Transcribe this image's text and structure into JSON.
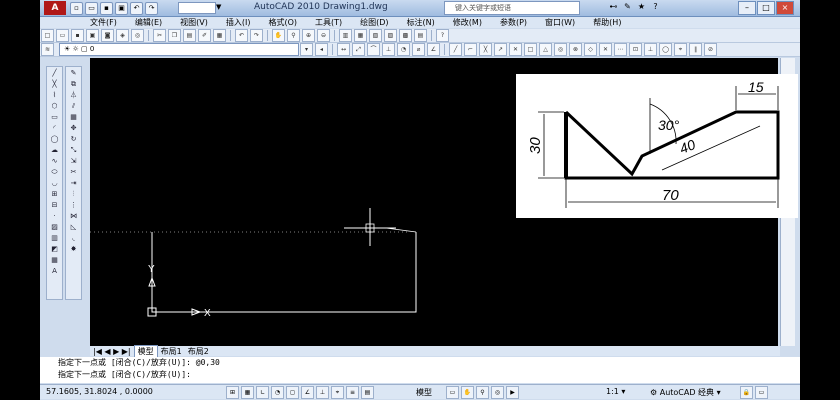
{
  "app": {
    "title": "AutoCAD 2010    Drawing1.dwg",
    "logo": "A",
    "search_placeholder": "键入关键字或短语",
    "workspace_label": ""
  },
  "menu": [
    "文件(F)",
    "编辑(E)",
    "视图(V)",
    "插入(I)",
    "格式(O)",
    "工具(T)",
    "绘图(D)",
    "标注(N)",
    "修改(M)",
    "参数(P)",
    "窗口(W)",
    "帮助(H)"
  ],
  "layer": {
    "current": "0"
  },
  "layout_tabs": {
    "model": "模型",
    "layout1": "布局1",
    "layout2": "布局2"
  },
  "command": {
    "line1": "指定下一点或 [闭合(C)/放弃(U)]: @0,30",
    "line2": "指定下一点或 [闭合(C)/放弃(U)]:"
  },
  "status": {
    "coords": "57.1605,  31.8024 , 0.0000",
    "model": "模型",
    "scale": "1:1",
    "workspace": "AutoCAD 经典"
  },
  "reference": {
    "dim_width": "70",
    "dim_height": "30",
    "dim_top": "15",
    "dim_angle": "30°",
    "dim_slope": "40"
  },
  "colors": {
    "canvas": "#000000",
    "line": "#ffffff",
    "accent": "#b01818"
  }
}
